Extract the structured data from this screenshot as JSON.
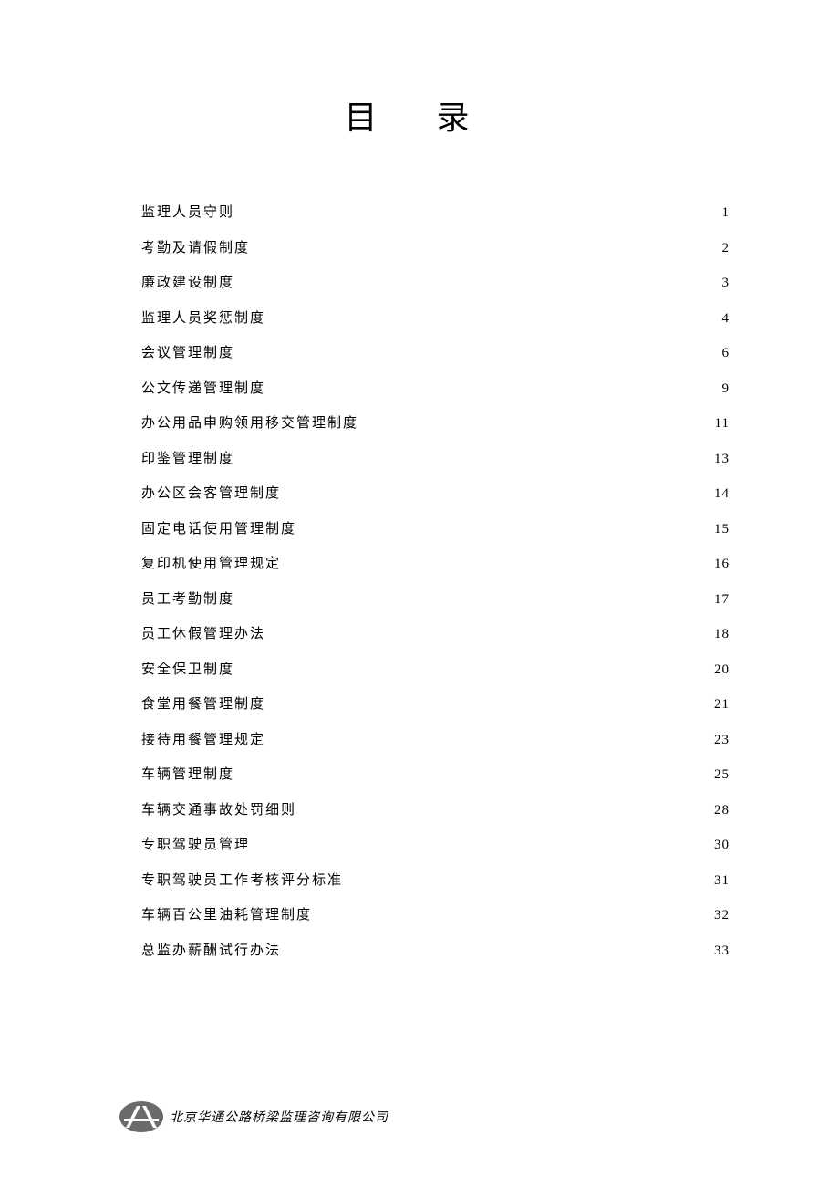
{
  "title": "目 录",
  "toc": [
    {
      "label": "监理人员守则",
      "page": "1"
    },
    {
      "label": "考勤及请假制度",
      "page": "2"
    },
    {
      "label": "廉政建设制度",
      "page": "3"
    },
    {
      "label": "监理人员奖惩制度",
      "page": "4"
    },
    {
      "label": "会议管理制度",
      "page": "6"
    },
    {
      "label": "公文传递管理制度",
      "page": "9"
    },
    {
      "label": "办公用品申购领用移交管理制度",
      "page": "11"
    },
    {
      "label": "印鉴管理制度",
      "page": "13"
    },
    {
      "label": "办公区会客管理制度",
      "page": "14"
    },
    {
      "label": "固定电话使用管理制度",
      "page": "15"
    },
    {
      "label": "复印机使用管理规定",
      "page": "16"
    },
    {
      "label": "员工考勤制度",
      "page": "17"
    },
    {
      "label": "员工休假管理办法",
      "page": "18"
    },
    {
      "label": "安全保卫制度",
      "page": "20"
    },
    {
      "label": "食堂用餐管理制度",
      "page": "21"
    },
    {
      "label": "接待用餐管理规定",
      "page": "23"
    },
    {
      "label": "车辆管理制度",
      "page": "25"
    },
    {
      "label": "车辆交通事故处罚细则",
      "page": "28"
    },
    {
      "label": "专职驾驶员管理",
      "page": "30"
    },
    {
      "label": "专职驾驶员工作考核评分标准",
      "page": "31"
    },
    {
      "label": "车辆百公里油耗管理制度",
      "page": "32"
    },
    {
      "label": "总监办薪酬试行办法",
      "page": "33"
    }
  ],
  "footer": {
    "company": "北京华通公路桥梁监理咨询有限公司"
  }
}
